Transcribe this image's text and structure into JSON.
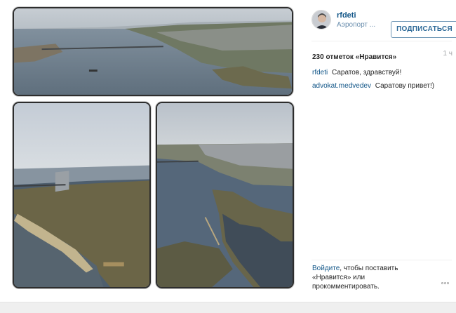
{
  "post": {
    "username": "rfdeti",
    "location": "Аэропорт ...",
    "follow_label": "ПОДПИСАТЬСЯ",
    "likes": "230 отметок «Нравится»",
    "time": "1 ч",
    "comments": [
      {
        "author": "rfdeti",
        "text": "Саратов, здравствуй!"
      },
      {
        "author": "advokat.medvedev",
        "text": "Саратову привет!)"
      }
    ],
    "login_prompt": {
      "link": "Войдите",
      "rest_line1": ", чтобы поставить",
      "line2": "«Нравится» или",
      "line3": "прокомментировать."
    }
  },
  "icons": {
    "avatar": "avatar",
    "more": "more-options-icon"
  }
}
